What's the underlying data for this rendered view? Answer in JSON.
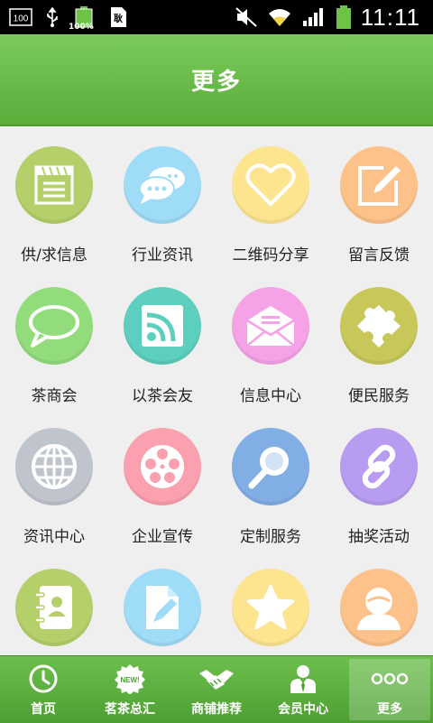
{
  "status_bar": {
    "time": "11:11",
    "battery_percent": "100%",
    "notification_badge": "100",
    "icons": [
      "notification-box-icon",
      "usb-icon",
      "battery-charging-icon",
      "sim-icon",
      "mute-icon",
      "wifi-icon",
      "signal-icon",
      "battery-icon"
    ]
  },
  "header": {
    "title": "更多"
  },
  "grid": {
    "items": [
      {
        "label": "供/求信息",
        "icon": "document-icon",
        "color": "#b5d06a"
      },
      {
        "label": "行业资讯",
        "icon": "chat-bubbles-icon",
        "color": "#9fdcf7"
      },
      {
        "label": "二维码分享",
        "icon": "heart-icon",
        "color": "#fde58f"
      },
      {
        "label": "留言反馈",
        "icon": "pencil-edit-icon",
        "color": "#fdc28a"
      },
      {
        "label": "茶商会",
        "icon": "speech-bubble-icon",
        "color": "#93dc7c"
      },
      {
        "label": "以茶会友",
        "icon": "rss-icon",
        "color": "#5ccfbe"
      },
      {
        "label": "信息中心",
        "icon": "envelope-icon",
        "color": "#f6a2e6"
      },
      {
        "label": "便民服务",
        "icon": "puzzle-icon",
        "color": "#c8c85a"
      },
      {
        "label": "资讯中心",
        "icon": "globe-icon",
        "color": "#c0c4cc"
      },
      {
        "label": "企业宣传",
        "icon": "film-reel-icon",
        "color": "#fba0ae"
      },
      {
        "label": "定制服务",
        "icon": "magnifier-icon",
        "color": "#82aee6"
      },
      {
        "label": "抽奖活动",
        "icon": "chain-link-icon",
        "color": "#b89cf1"
      },
      {
        "label": "",
        "icon": "contacts-book-icon",
        "color": "#b5d06a"
      },
      {
        "label": "",
        "icon": "edit-file-icon",
        "color": "#9fdcf7"
      },
      {
        "label": "",
        "icon": "star-icon",
        "color": "#fde58f"
      },
      {
        "label": "",
        "icon": "user-avatar-icon",
        "color": "#fdc28a"
      }
    ]
  },
  "tabbar": {
    "tabs": [
      {
        "label": "首页",
        "icon": "clock-icon",
        "active": false
      },
      {
        "label": "茗茶总汇",
        "icon": "new-badge-icon",
        "active": false
      },
      {
        "label": "商铺推荐",
        "icon": "handshake-icon",
        "active": false
      },
      {
        "label": "会员中心",
        "icon": "member-icon",
        "active": false
      },
      {
        "label": "更多",
        "icon": "more-dots-icon",
        "active": true
      }
    ],
    "new_badge_text": "NEW!"
  }
}
